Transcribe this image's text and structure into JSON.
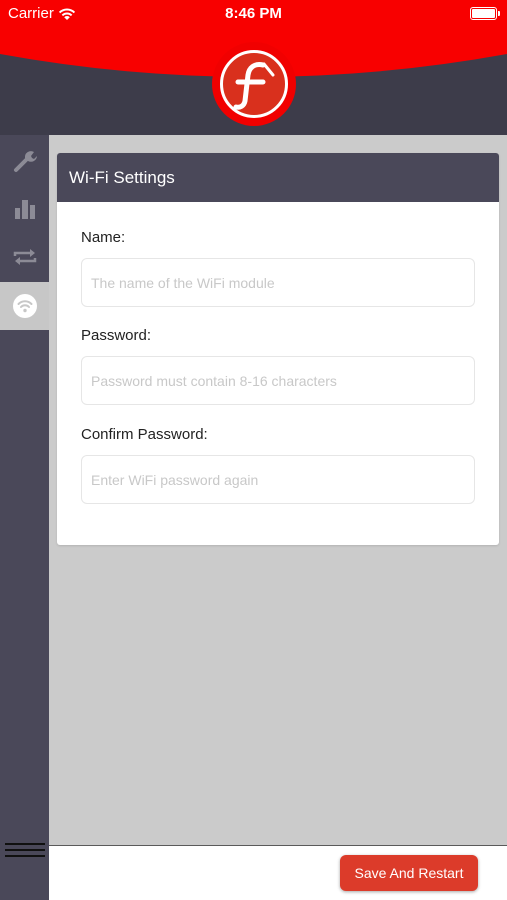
{
  "status_bar": {
    "carrier": "Carrier",
    "time": "8:46 PM"
  },
  "header": {
    "logo_icon": "f-logo-icon"
  },
  "sidebar": {
    "items": [
      {
        "icon": "wrench-icon",
        "active": false
      },
      {
        "icon": "bar-chart-icon",
        "active": false
      },
      {
        "icon": "sync-arrows-icon",
        "active": false
      },
      {
        "icon": "wifi-icon",
        "active": true
      }
    ],
    "menu_icon": "hamburger-menu-icon"
  },
  "card": {
    "title": "Wi-Fi Settings",
    "fields": {
      "name": {
        "label": "Name:",
        "placeholder": "The name of the WiFi module",
        "value": ""
      },
      "password": {
        "label": "Password:",
        "placeholder": "Password must contain 8-16 characters",
        "value": ""
      },
      "confirm_password": {
        "label": "Confirm Password:",
        "placeholder": "Enter WiFi password again",
        "value": ""
      }
    }
  },
  "footer": {
    "save_label": "Save And Restart"
  },
  "colors": {
    "brand_red": "#f80000",
    "dark_header": "#3d3c4a",
    "sidebar": "#4a4859",
    "button": "#dc3b2a",
    "background": "#cbcbcb"
  }
}
